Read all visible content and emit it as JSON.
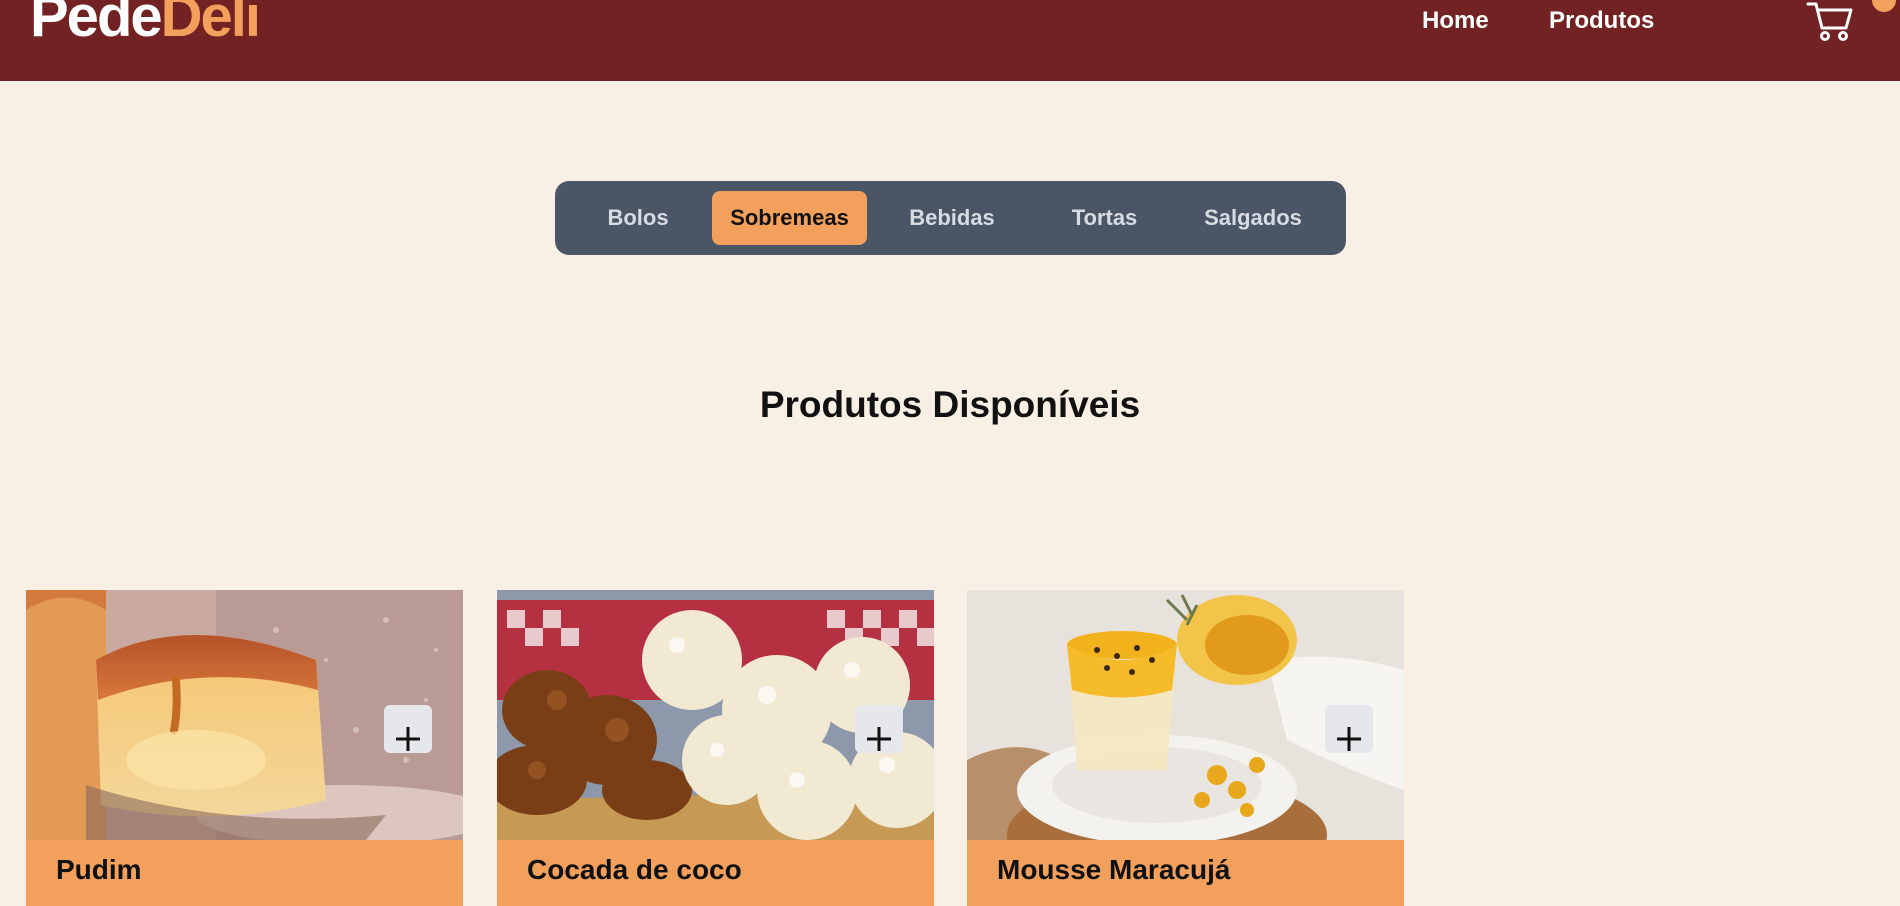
{
  "header": {
    "logo_part1": "Pede",
    "logo_part2": "Deli",
    "nav": [
      {
        "label": "Home"
      },
      {
        "label": "Produtos"
      }
    ],
    "cart_icon": "cart-icon"
  },
  "categories": {
    "selected": "Sobremeas",
    "tabs": [
      {
        "label": "Bolos"
      },
      {
        "label": "Sobremeas"
      },
      {
        "label": "Bebidas"
      },
      {
        "label": "Tortas"
      },
      {
        "label": "Salgados"
      }
    ]
  },
  "main": {
    "title": "Produtos Disponíveis",
    "products": [
      {
        "name": "Pudim",
        "image": "pudim-photo",
        "add_icon": "plus-icon"
      },
      {
        "name": "Cocada de coco",
        "image": "cocada-photo",
        "add_icon": "plus-icon"
      },
      {
        "name": "Mousse Maracujá",
        "image": "mousse-photo",
        "add_icon": "plus-icon"
      }
    ]
  },
  "colors": {
    "header_bg": "#722222",
    "accent": "#f3a05d",
    "page_bg": "#f8f0e4",
    "tabs_bg": "#4a5566"
  }
}
